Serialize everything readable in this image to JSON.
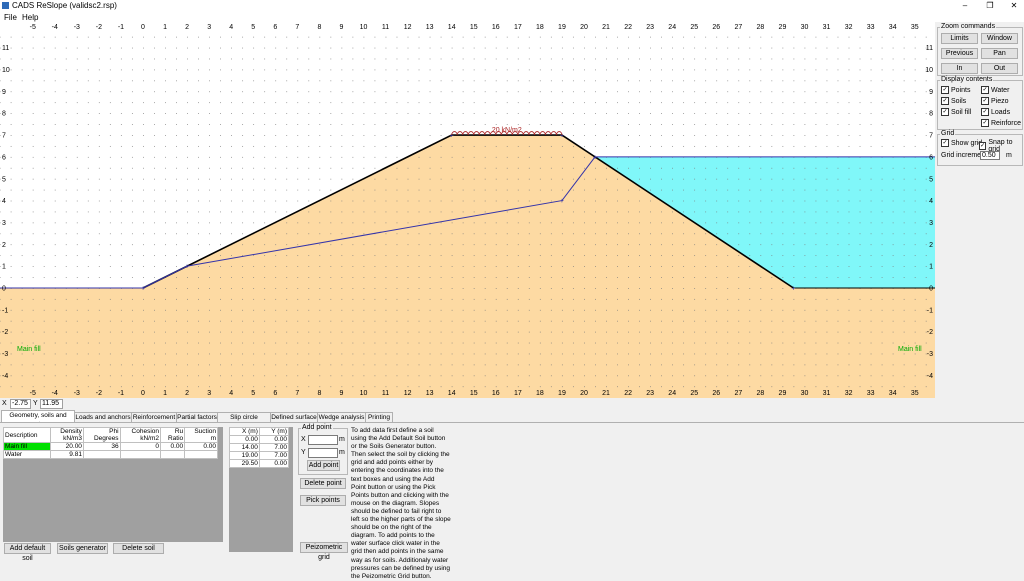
{
  "window": {
    "title": "CADS ReSlope (validsc2.rsp)"
  },
  "menu": {
    "items": [
      "File",
      "Help"
    ]
  },
  "canvas": {
    "x_ticks": [
      "-5",
      "-4",
      "-3",
      "-2",
      "-1",
      "0",
      "1",
      "2",
      "3",
      "4",
      "5",
      "6",
      "7",
      "8",
      "9",
      "10",
      "11",
      "12",
      "13",
      "14",
      "15",
      "16",
      "17",
      "18",
      "19",
      "20",
      "21",
      "22",
      "23",
      "24",
      "25",
      "26",
      "27",
      "28",
      "29",
      "30",
      "31",
      "32",
      "33",
      "34",
      "35"
    ],
    "y_ticks": [
      "11",
      "10",
      "9",
      "8",
      "7",
      "6",
      "5",
      "4",
      "3",
      "2",
      "1",
      "0",
      "-1",
      "-2",
      "-3",
      "-4"
    ],
    "load_label": "20 kN/m2",
    "soil_label_left": "Main fill",
    "soil_label_right": "Main fill",
    "colors": {
      "soil": "#fddaa3",
      "water": "#80f7f9",
      "slope_line": "#000000",
      "piezo_line": "#3333aa",
      "load": "#aa2222",
      "soil_label": "#00aa00",
      "selected_row": "#00e000",
      "dots": "#7a7a7a"
    }
  },
  "right_panel": {
    "zoom": {
      "title": "Zoom commands",
      "buttons": [
        "Limits",
        "Window",
        "Previous",
        "Pan",
        "In",
        "Out"
      ]
    },
    "display": {
      "title": "Display contents",
      "items": [
        {
          "label": "Points",
          "checked": true
        },
        {
          "label": "Water",
          "checked": true
        },
        {
          "label": "Soils",
          "checked": true
        },
        {
          "label": "Piezo",
          "checked": true
        },
        {
          "label": "Soil fill",
          "checked": true
        },
        {
          "label": "Loads",
          "checked": true
        },
        {
          "label": "Reinforce",
          "checked": true
        }
      ]
    },
    "grid": {
      "title": "Grid",
      "show_grid": "Show grid",
      "snap": "Snap to grid",
      "increment_label": "Grid increment",
      "increment_value": "0.50",
      "unit": "m"
    }
  },
  "coords": {
    "x_label": "X",
    "x_value": "-2.75",
    "y_label": "Y",
    "y_value": "11.95"
  },
  "tabs": [
    "Geometry, soils and water",
    "Loads and anchors",
    "Reinforcement",
    "Partial factors",
    "Slip circle analysis",
    "Defined surface",
    "Wedge analysis",
    "Printing"
  ],
  "soils": {
    "headers": [
      [
        "Description",
        ""
      ],
      [
        "Density",
        "kN/m3"
      ],
      [
        "Phi",
        "Degrees"
      ],
      [
        "Cohesion",
        "kN/m2"
      ],
      [
        "Ru",
        "Ratio"
      ],
      [
        "Suction",
        "m"
      ]
    ],
    "rows": [
      [
        "Main fill",
        "20.00",
        "36",
        "0",
        "0.00",
        "0.00"
      ],
      [
        "Water",
        "9.81",
        "",
        "",
        "",
        ""
      ]
    ],
    "buttons": [
      "Add default soil",
      "Soils generator",
      "Delete soil"
    ]
  },
  "points": {
    "headers": [
      "X (m)",
      "Y (m)"
    ],
    "rows": [
      [
        "0.00",
        "0.00"
      ],
      [
        "14.00",
        "7.00"
      ],
      [
        "19.00",
        "7.00"
      ],
      [
        "29.50",
        "0.00"
      ]
    ]
  },
  "add_point": {
    "title": "Add point",
    "x_label": "X",
    "y_label": "Y",
    "unit": "m",
    "add_button": "Add point",
    "delete_button": "Delete point",
    "pick_button": "Pick points",
    "piezo_button": "Peizometric grid"
  },
  "help_text": "To add data first define a soil using the Add Default Soil button or the Soils Generator button. Then select the soil by clicking the grid and add points either by entering the coordinates into the text boxes and using the Add Point button or using the Pick Points button and clicking with the mouse on the diagram. Slopes should be defined to fail right to left so the higher parts of the slope should be on the right of the diagram. To add points to the water surface click water in the grid then add points in the same way as for soils. Additionaly water pressures can be defined by using the Peizometric Grid button."
}
